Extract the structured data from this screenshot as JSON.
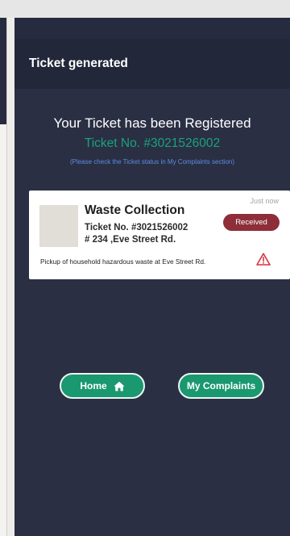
{
  "app_bar": {
    "title": "Ticket generated"
  },
  "confirmation": {
    "heading": "Your Ticket has been Registered",
    "ticket_line": "Ticket No. #3021526002",
    "note": "(Please check the Ticket status in My Complaints section)"
  },
  "card": {
    "title": "Waste Collection",
    "ticket": "Ticket No. #3021526002",
    "address": "# 234 ,Eve Street Rd.",
    "time": "Just now",
    "status": "Received",
    "description": "Pickup of household hazardous waste at Eve Street Rd.",
    "warning_icon": "warning-triangle-icon"
  },
  "buttons": {
    "home_label": "Home",
    "home_icon": "home-icon",
    "complaints_label": "My Complaints"
  },
  "colors": {
    "background": "#2a2f44",
    "app_bar": "#22273a",
    "accent_green": "#1aa37a",
    "note_blue": "#5d8de0",
    "status_red": "#8e2e39",
    "warning_red": "#d9343f"
  }
}
